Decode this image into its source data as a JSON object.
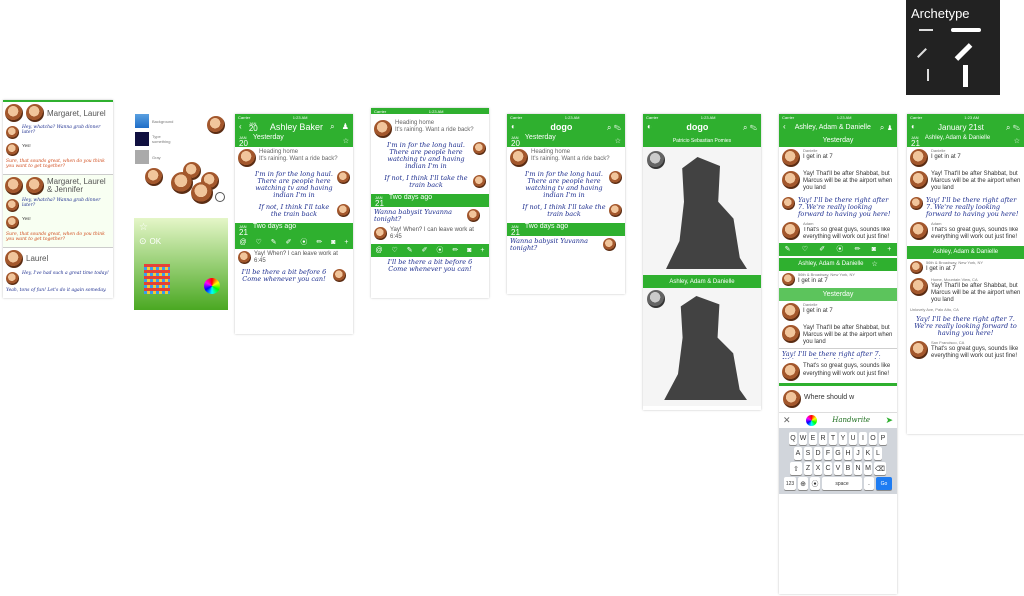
{
  "archetype": {
    "title": "Archetype"
  },
  "status": {
    "carrier": "Carrier",
    "time": "1:23 AM",
    "time_alt": "1:22 AM"
  },
  "inbox": {
    "threads": [
      {
        "name": "Margaret, Laurel",
        "m1": "Hey, whatcha? Wanna grab dinner later?",
        "reply": "Yes!",
        "m2": "Sure, that sounds great, when do you think you want to get together?"
      },
      {
        "name": "Margaret, Laurel & Jennifer",
        "m1": "Hey, whatcha? Wanna grab dinner later?",
        "reply": "Yes!",
        "m2": "Sure, that sounds great, when do you think you want to get together?"
      },
      {
        "name": "Laurel",
        "m1": "Hey, I've had such a great time today!",
        "m2": "Yeah, tons of fun! Let's do it again someday."
      }
    ]
  },
  "palette": {
    "labels": [
      "Background",
      "Type something",
      "Gray"
    ],
    "ok": "OK"
  },
  "convo": {
    "title": "Ashley Baker",
    "yesterday": "Yesterday",
    "two_days": "Two days ago",
    "d1": {
      "mon": "JAN",
      "day": "20"
    },
    "d2": {
      "mon": "JAN",
      "day": "21"
    },
    "heading": "Heading home",
    "raining": "It's raining. Want a ride back?",
    "hw1": "I'm in for the long haul. There are people here watching tv and having indian I'm in",
    "hw2": "If not, I think I'll take the train back",
    "babysit": "Wanna babysit Yuvanna tonight?",
    "yay": "Yay! When? I can leave work at 6:45",
    "hw3": "I'll be there a bit before 6 Come whenever you can!"
  },
  "dogo": {
    "title": "dogo"
  },
  "sketch": {
    "patricio": "Patricio Sebastian Pomies",
    "group": "Ashley, Adam & Danielle"
  },
  "group": {
    "title": "Ashley, Adam & Danielle",
    "yesterday": "Yesterday",
    "danielle": "Danielle",
    "get_in": "I get in at 7",
    "shabbat": "Yay! That'll be after Shabbat, but Marcus will be at the airport when you land",
    "hw": "Yay! I'll be there right after 7. We're really looking forward to having you here!",
    "adam": "Adam",
    "great": "That's so great guys, sounds like everything will work out just fine!",
    "loc1": "56th & Broadway, New York, NY",
    "loc2": "Home, Mountain View, CA",
    "loc3": "Unlovely Ave, Palo Alto, CA",
    "loc4": "San Francisco, CA",
    "input": "Where should w",
    "handwrite": "Handwrite",
    "keys": {
      "r1": [
        "Q",
        "W",
        "E",
        "R",
        "T",
        "Y",
        "U",
        "I",
        "O",
        "P"
      ],
      "r2": [
        "A",
        "S",
        "D",
        "F",
        "G",
        "H",
        "J",
        "K",
        "L"
      ],
      "r3": [
        "Z",
        "X",
        "C",
        "V",
        "B",
        "N",
        "M"
      ],
      "num": "123",
      "space": "space",
      "go": "Go"
    }
  },
  "jan": {
    "title": "January 21st",
    "group": "Ashley, Adam & Danielle"
  }
}
